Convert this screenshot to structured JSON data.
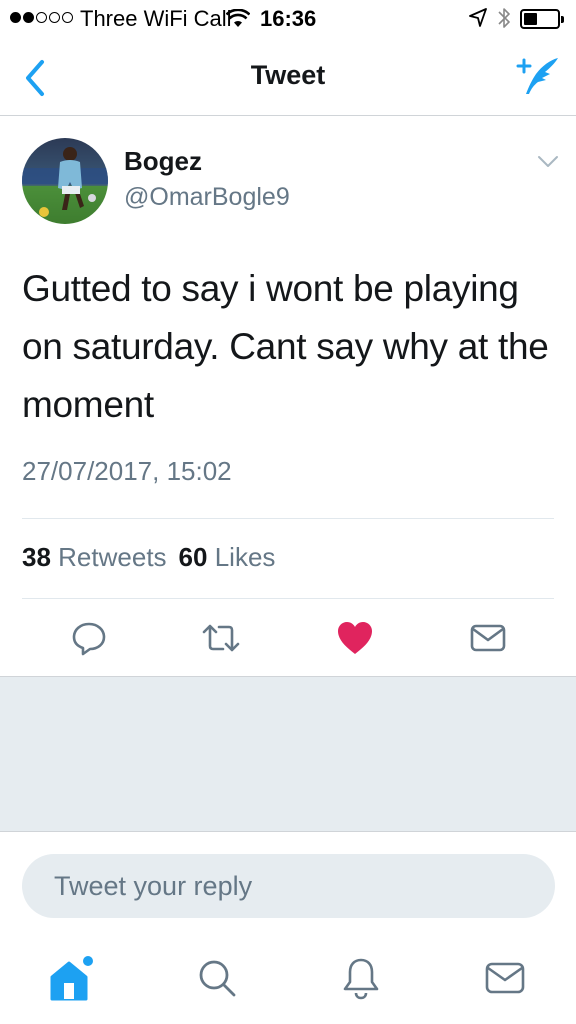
{
  "status_bar": {
    "carrier": "Three WiFi Call",
    "time": "16:36",
    "signal_bars_filled": 2,
    "signal_bars_total": 5,
    "battery_level": 0.4
  },
  "nav": {
    "title": "Tweet",
    "back_icon": "chevron-left-icon",
    "compose_icon": "compose-tweet-icon"
  },
  "tweet": {
    "display_name": "Bogez",
    "handle": "@OmarBogle9",
    "text": "Gutted to say i wont be playing on saturday. Cant say why at the moment",
    "timestamp": "27/07/2017, 15:02",
    "retweet_count": "38",
    "retweets_label": "Retweets",
    "like_count": "60",
    "likes_label": "Likes",
    "liked": true
  },
  "reply": {
    "placeholder": "Tweet your reply"
  },
  "colors": {
    "accent": "#1da1f2",
    "like": "#e0245e",
    "text_primary": "#14171a",
    "text_secondary": "#657786",
    "action_icon": "#657786",
    "background_gray": "#e6ecf0"
  },
  "tab_bar": {
    "items": [
      "home-icon",
      "search-icon",
      "notifications-icon",
      "messages-icon"
    ],
    "active": "home-icon"
  }
}
